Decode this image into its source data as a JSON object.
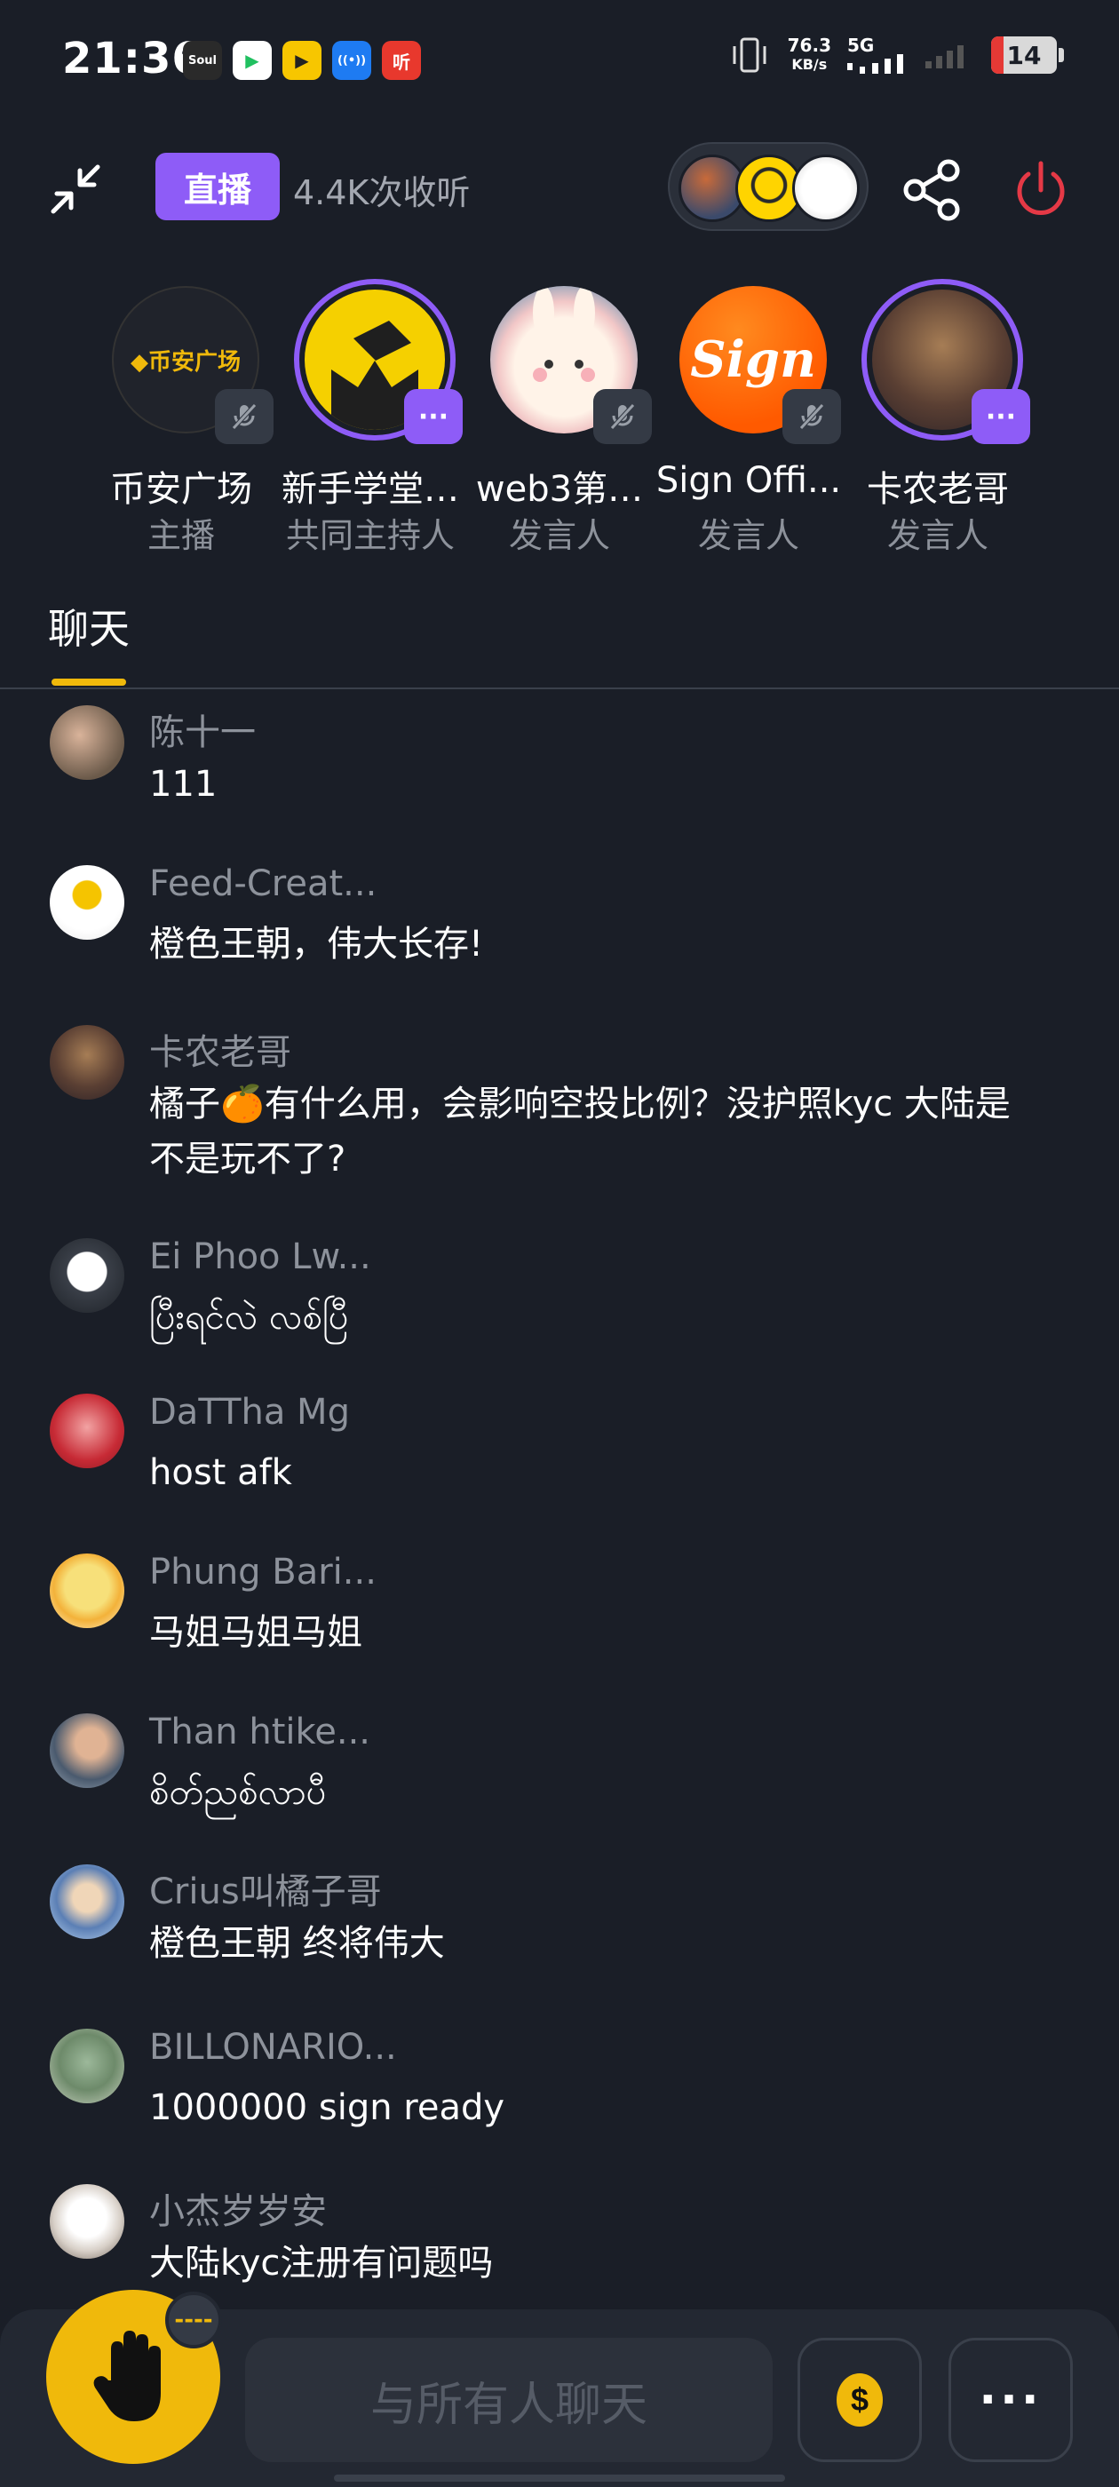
{
  "status_bar": {
    "time": "21:36",
    "apps": [
      {
        "name": "soul-app-icon",
        "label": "Soul",
        "color": "#2a2a2a"
      },
      {
        "name": "video-app-icon",
        "label": "▶",
        "color": "#ffffff"
      },
      {
        "name": "yellow-app-icon",
        "label": "▶",
        "color": "#f7c600"
      },
      {
        "name": "radio-app-icon",
        "label": "((•))",
        "color": "#1e7bf2"
      },
      {
        "name": "listen-app-icon",
        "label": "听",
        "color": "#e8382d"
      }
    ],
    "net_speed": "76.3",
    "net_unit": "KB/s",
    "network": "5G",
    "battery": "14"
  },
  "header": {
    "live_label": "直播",
    "listen_count": "4.4K次收听"
  },
  "speakers": [
    {
      "name": "币安广场",
      "role": "主播",
      "badge": "mute",
      "logo_text": "◆币安广场"
    },
    {
      "name": "新手学堂…",
      "role": "共同主持人",
      "badge": "more"
    },
    {
      "name": "web3第…",
      "role": "发言人",
      "badge": "mute"
    },
    {
      "name": "Sign Offi...",
      "role": "发言人",
      "badge": "mute",
      "logo_text": "Sign"
    },
    {
      "name": "卡农老哥",
      "role": "发言人",
      "badge": "more"
    }
  ],
  "tabs": {
    "chat": "聊天"
  },
  "messages": [
    {
      "name": "陈十一",
      "text": "111"
    },
    {
      "name": "Feed-Creat...",
      "text": "橙色王朝，伟大长存!"
    },
    {
      "name": "卡农老哥",
      "text": "橘子🍊有什么用，会影响空投比例？没护照kyc 大陆是不是玩不了?"
    },
    {
      "name": "Ei Phoo Lw...",
      "text": "ပြီးရင်လဲ လစ်ပြီ"
    },
    {
      "name": "DaTTha Mg",
      "text": "host afk"
    },
    {
      "name": "Phung Bari...",
      "text": "马姐马姐马姐"
    },
    {
      "name": "Than htike...",
      "text": "စိတ်ညစ်လာပီ"
    },
    {
      "name": "Crius叫橘子哥",
      "text": "橙色王朝 终将伟大"
    },
    {
      "name": "BILLONARIO...",
      "text": "1000000 sign ready"
    },
    {
      "name": "小杰岁岁安",
      "text": "大陆kyc注册有问题吗"
    }
  ],
  "bottom": {
    "raise_badge": "----",
    "input_placeholder": "与所有人聊天",
    "more_label": "···"
  },
  "colors": {
    "background": "#1a1e27",
    "accent_purple": "#8e5cf7",
    "accent_yellow": "#f0b90b",
    "power_red": "#e53946",
    "muted_text": "#8d929b"
  }
}
